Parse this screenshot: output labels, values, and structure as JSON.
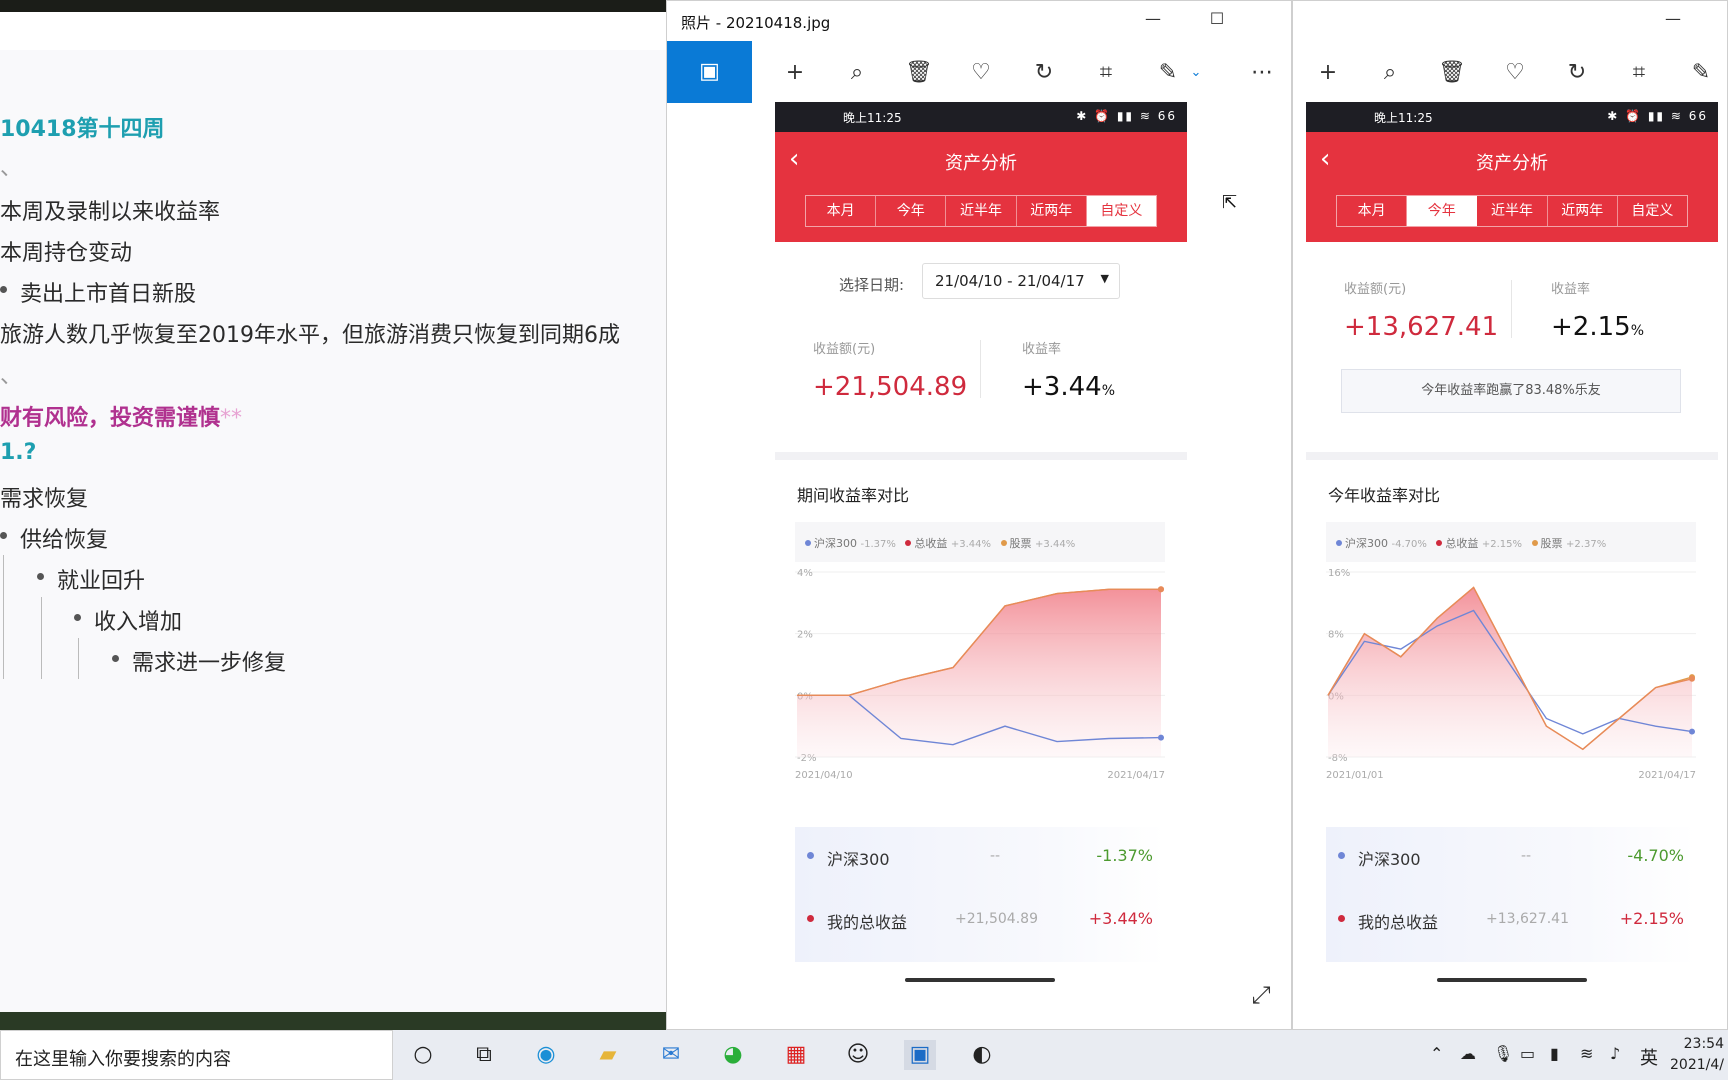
{
  "notes": {
    "lines": [
      {
        "text": "10418第十四周"
      },
      {
        "text": "、"
      },
      {
        "text": "本周及录制以来收益率"
      },
      {
        "text": "本周持仓变动"
      },
      {
        "text": "卖出上市首日新股"
      },
      {
        "text": "旅游人数几乎恢复至2019年水平，但旅游消费只恢复到同期6成"
      },
      {
        "text": "、"
      },
      {
        "text": "财有风险，投资需谨慎"
      },
      {
        "text": "**"
      },
      {
        "text": "1.?"
      },
      {
        "text": "需求恢复"
      },
      {
        "text": "供给恢复"
      },
      {
        "text": "就业回升"
      },
      {
        "text": "收入增加"
      },
      {
        "text": "需求进一步修复"
      }
    ]
  },
  "photos_main": {
    "title": "照片 - 20210418.jpg",
    "min": "—",
    "max": "☐",
    "more": "⋯",
    "phone": {
      "status_time": "晚上11:25",
      "status_icons": "✱ ⏰ ▮▮ ≋ 66",
      "back": "‹",
      "title": "资产分析",
      "tabs": [
        "本月",
        "今年",
        "近半年",
        "近两年",
        "自定义"
      ],
      "date_label": "选择日期:",
      "date_value": "21/04/10 - 21/04/17",
      "profit_label": "收益额(元)",
      "profit_value": "+21,504.89",
      "rate_label": "收益率",
      "rate_value": "+3.44",
      "rate_unit": "%",
      "section_title": "期间收益率对比",
      "legend": [
        {
          "name": "沪深300",
          "value": "-1.37%",
          "color": "#6f86d6"
        },
        {
          "name": "总收益",
          "value": "+3.44%",
          "color": "#cf2a3d"
        },
        {
          "name": "股票",
          "value": "+3.44%",
          "color": "#e09a4a"
        }
      ],
      "y_ticks": [
        "4%",
        "2%",
        "0%",
        "-2%"
      ],
      "x_start": "2021/04/10",
      "x_end": "2021/04/17",
      "summary": [
        {
          "name": "沪深300",
          "mid": "--",
          "pct": "-1.37%"
        },
        {
          "name": "我的总收益",
          "mid": "+21,504.89",
          "pct": "+3.44%"
        }
      ]
    }
  },
  "photos_second": {
    "phone": {
      "status_time": "晚上11:25",
      "status_icons": "✱ ⏰ ▮▮ ≋ 66",
      "back": "‹",
      "title": "资产分析",
      "tabs": [
        "本月",
        "今年",
        "近半年",
        "近两年",
        "自定义"
      ],
      "profit_label": "收益额(元)",
      "profit_value": "+13,627.41",
      "rate_label": "收益率",
      "rate_value": "+2.15",
      "rate_unit": "%",
      "beat_note": "今年收益率跑赢了83.48%乐友",
      "section_title": "今年收益率对比",
      "legend": [
        {
          "name": "沪深300",
          "value": "-4.70%",
          "color": "#6f86d6"
        },
        {
          "name": "总收益",
          "value": "+2.15%",
          "color": "#cf2a3d"
        },
        {
          "name": "股票",
          "value": "+2.37%",
          "color": "#e09a4a"
        }
      ],
      "y_ticks": [
        "16%",
        "8%",
        "0%",
        "-8%"
      ],
      "x_start": "2021/01/01",
      "x_end": "2021/04/17",
      "summary": [
        {
          "name": "沪深300",
          "mid": "--",
          "pct": "-4.70%"
        },
        {
          "name": "我的总收益",
          "mid": "+13,627.41",
          "pct": "+2.15%"
        }
      ]
    }
  },
  "chart_data": [
    {
      "type": "area",
      "x": [
        "2021/04/10",
        "2021/04/11",
        "2021/04/12",
        "2021/04/13",
        "2021/04/14",
        "2021/04/15",
        "2021/04/16",
        "2021/04/17"
      ],
      "series": [
        {
          "name": "沪深300",
          "values": [
            0,
            0,
            -1.4,
            -1.6,
            -1.0,
            -1.5,
            -1.4,
            -1.37
          ]
        },
        {
          "name": "总收益",
          "values": [
            0,
            0,
            0.5,
            0.9,
            2.9,
            3.3,
            3.44,
            3.44
          ]
        },
        {
          "name": "股票",
          "values": [
            0,
            0,
            0.5,
            0.9,
            2.9,
            3.3,
            3.44,
            3.44
          ]
        }
      ],
      "ylim": [
        -2,
        4
      ]
    },
    {
      "type": "area",
      "x": [
        "2021/01/01",
        "2021/01/15",
        "2021/02/01",
        "2021/02/10",
        "2021/02/18",
        "2021/02/26",
        "2021/03/08",
        "2021/03/17",
        "2021/03/26",
        "2021/04/06",
        "2021/04/17"
      ],
      "series": [
        {
          "name": "沪深300",
          "values": [
            0,
            7,
            6,
            9,
            11,
            4,
            -3,
            -5,
            -3,
            -4,
            -4.7
          ]
        },
        {
          "name": "总收益",
          "values": [
            0,
            8,
            5,
            10,
            14,
            5,
            -4,
            -7,
            -3,
            1,
            2.15
          ]
        },
        {
          "name": "股票",
          "values": [
            0,
            8,
            5,
            10,
            14,
            5,
            -4,
            -7,
            -3,
            1,
            2.37
          ]
        }
      ],
      "ylim": [
        -8,
        16
      ]
    }
  ],
  "taskbar": {
    "search_placeholder": "在这里输入你要搜索的内容",
    "ime": "英",
    "time": "23:54",
    "date": "2021/4/"
  }
}
